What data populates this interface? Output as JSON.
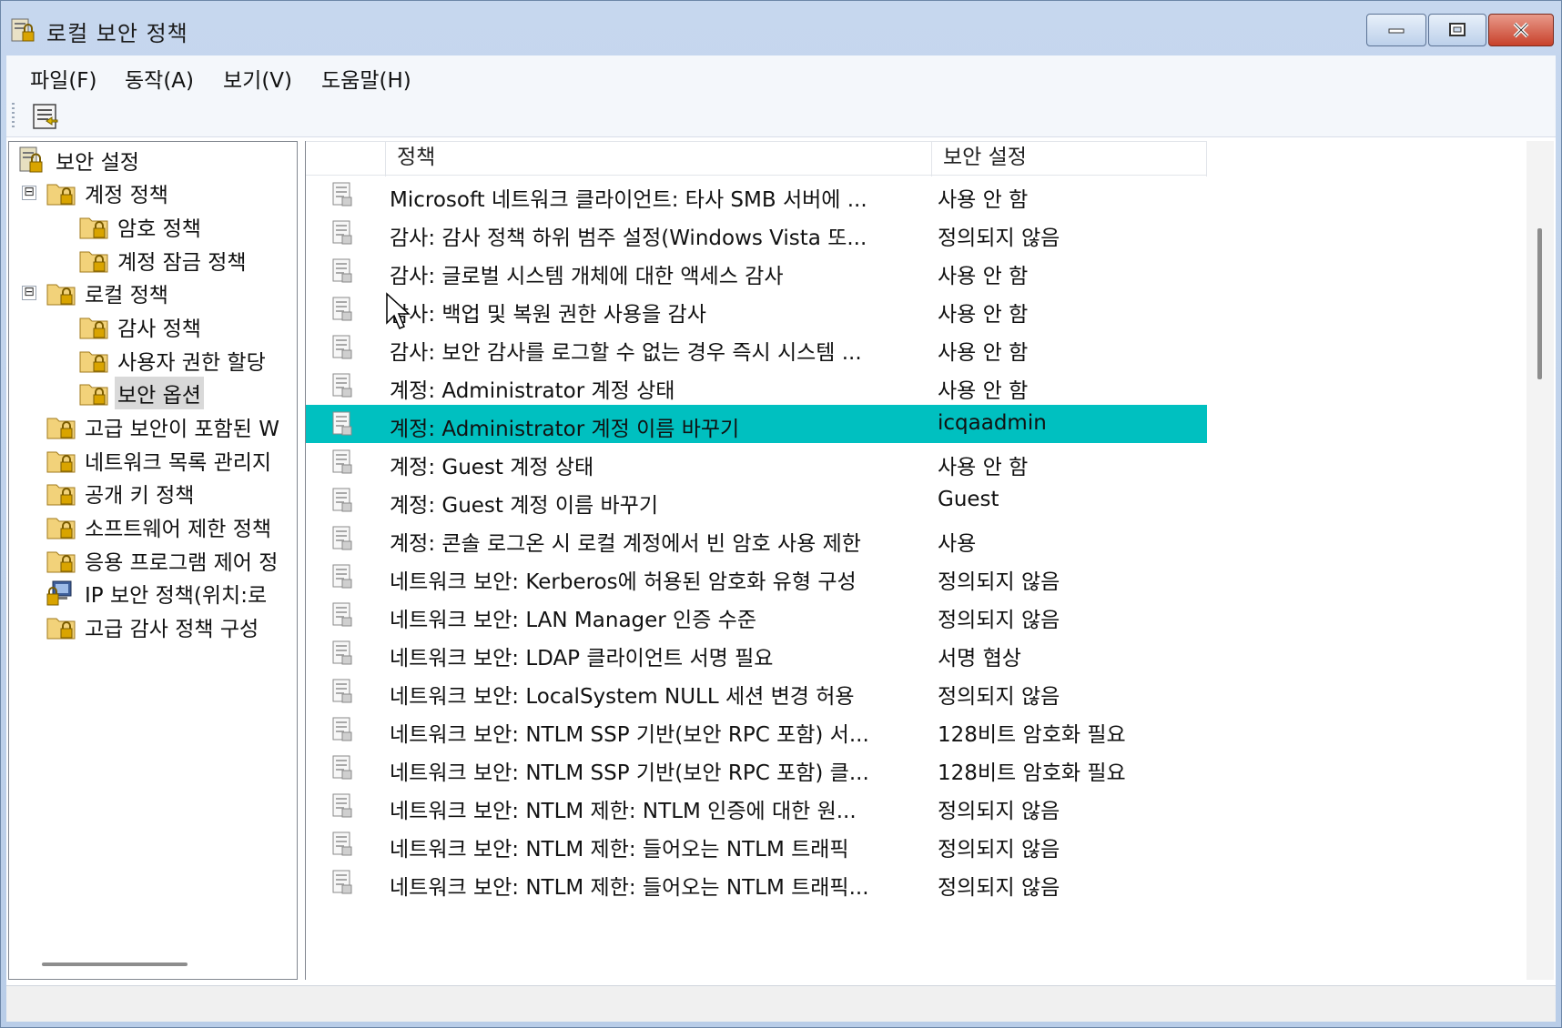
{
  "window": {
    "title": "로컬 보안 정책"
  },
  "menubar": {
    "items": [
      {
        "label": "파일(F)"
      },
      {
        "label": "동작(A)"
      },
      {
        "label": "보기(V)"
      },
      {
        "label": "도움말(H)"
      }
    ]
  },
  "tree": {
    "nodes": [
      {
        "label": "보안 설정",
        "icon": "security-settings-icon"
      },
      {
        "label": "계정 정책",
        "icon": "folder-lock-icon",
        "toggle": "⊟"
      },
      {
        "label": "암호 정책",
        "icon": "folder-lock-icon"
      },
      {
        "label": "계정 잠금 정책",
        "icon": "folder-lock-icon"
      },
      {
        "label": "로컬 정책",
        "icon": "folder-lock-icon",
        "toggle": "⊟"
      },
      {
        "label": "감사 정책",
        "icon": "folder-lock-icon"
      },
      {
        "label": "사용자 권한 할당",
        "icon": "folder-lock-icon"
      },
      {
        "label": "보안 옵션",
        "icon": "folder-lock-icon",
        "selected": true
      },
      {
        "label": "고급 보안이 포함된 W",
        "icon": "folder-lock-icon"
      },
      {
        "label": "네트워크 목록 관리지",
        "icon": "folder-lock-icon"
      },
      {
        "label": "공개 키 정책",
        "icon": "folder-lock-icon"
      },
      {
        "label": "소프트웨어 제한 정책",
        "icon": "folder-lock-icon"
      },
      {
        "label": "응용 프로그램 제어 정",
        "icon": "folder-lock-icon"
      },
      {
        "label": "IP 보안 정책(위치:로",
        "icon": "computer-policy-icon"
      },
      {
        "label": "고급 감사 정책 구성",
        "icon": "folder-lock-icon"
      }
    ]
  },
  "list": {
    "columns": {
      "policy": "정책",
      "setting": "보안 설정"
    },
    "rows": [
      {
        "policy": "Microsoft 네트워크 클라이언트: 타사 SMB 서버에 ...",
        "setting": "사용 안 함"
      },
      {
        "policy": "감사: 감사 정책 하위 범주 설정(Windows Vista 또...",
        "setting": "정의되지 않음"
      },
      {
        "policy": "감사: 글로벌 시스템 개체에 대한 액세스 감사",
        "setting": "사용 안 함"
      },
      {
        "policy": "감사: 백업 및 복원 권한 사용을 감사",
        "setting": "사용 안 함"
      },
      {
        "policy": "감사: 보안 감사를 로그할 수 없는 경우 즉시 시스템 ...",
        "setting": "사용 안 함"
      },
      {
        "policy": "계정: Administrator 계정 상태",
        "setting": "사용 안 함"
      },
      {
        "policy": "계정: Administrator 계정 이름 바꾸기",
        "setting": "icqaadmin",
        "selected": true
      },
      {
        "policy": "계정: Guest 계정 상태",
        "setting": "사용 안 함"
      },
      {
        "policy": "계정: Guest 계정 이름 바꾸기",
        "setting": "Guest"
      },
      {
        "policy": "계정: 콘솔 로그온 시 로컬 계정에서 빈 암호 사용 제한",
        "setting": "사용"
      },
      {
        "policy": "네트워크 보안: Kerberos에 허용된 암호화 유형 구성",
        "setting": "정의되지 않음"
      },
      {
        "policy": "네트워크 보안: LAN Manager 인증 수준",
        "setting": "정의되지 않음"
      },
      {
        "policy": "네트워크 보안: LDAP 클라이언트 서명 필요",
        "setting": "서명 협상"
      },
      {
        "policy": "네트워크 보안: LocalSystem NULL 세션 변경 허용",
        "setting": "정의되지 않음"
      },
      {
        "policy": "네트워크 보안: NTLM SSP 기반(보안 RPC 포함) 서...",
        "setting": "128비트 암호화 필요"
      },
      {
        "policy": "네트워크 보안: NTLM SSP 기반(보안 RPC 포함) 클...",
        "setting": "128비트 암호화 필요"
      },
      {
        "policy": "네트워크 보안: NTLM 제한: NTLM 인증에 대한 원...",
        "setting": "정의되지 않음"
      },
      {
        "policy": "네트워크 보안: NTLM 제한: 들어오는 NTLM 트래픽",
        "setting": "정의되지 않음"
      },
      {
        "policy": "네트워크 보안: NTLM 제한: 들어오는 NTLM 트래픽...",
        "setting": "정의되지 않음"
      }
    ]
  },
  "colors": {
    "selection": "#00c0c0",
    "titlebar": "#c6d7ee",
    "close": "#c8412b"
  }
}
